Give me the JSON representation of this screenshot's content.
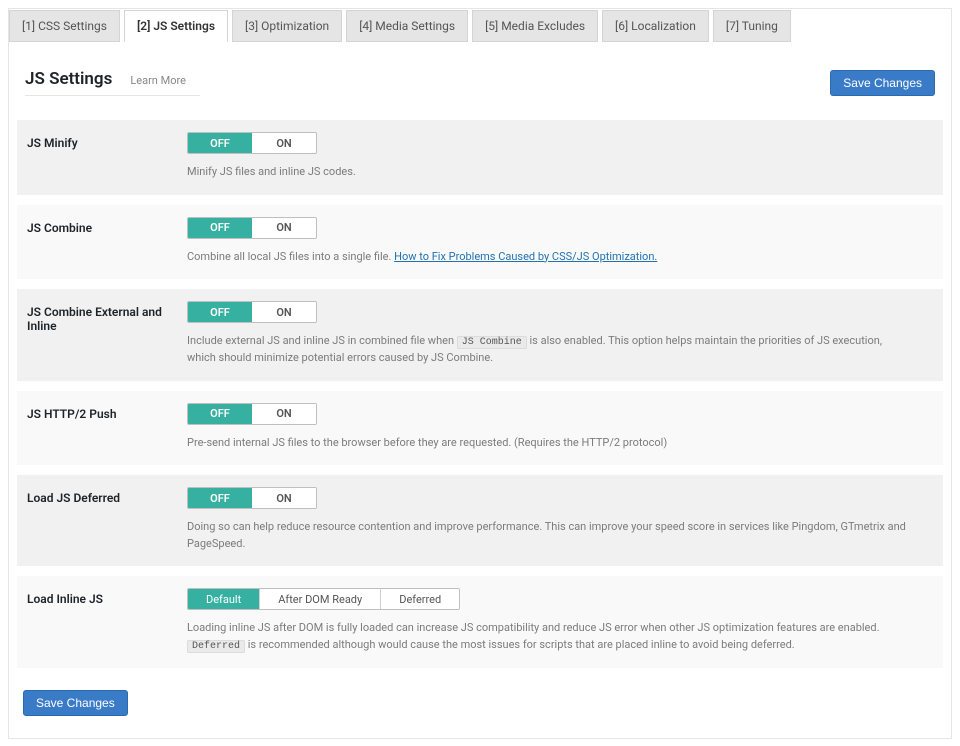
{
  "tabs": [
    {
      "label": "[1] CSS Settings"
    },
    {
      "label": "[2] JS Settings"
    },
    {
      "label": "[3] Optimization"
    },
    {
      "label": "[4] Media Settings"
    },
    {
      "label": "[5] Media Excludes"
    },
    {
      "label": "[6] Localization"
    },
    {
      "label": "[7] Tuning"
    }
  ],
  "header": {
    "title": "JS Settings",
    "learn_more": "Learn More",
    "save_changes": "Save Changes"
  },
  "toggle_labels": {
    "off": "OFF",
    "on": "ON"
  },
  "rows": {
    "minify": {
      "label": "JS Minify",
      "desc": "Minify JS files and inline JS codes."
    },
    "combine": {
      "label": "JS Combine",
      "desc_prefix": "Combine all local JS files into a single file. ",
      "desc_link": "How to Fix Problems Caused by CSS/JS Optimization."
    },
    "combine_ext": {
      "label": "JS Combine External and Inline",
      "desc_pre": "Include external JS and inline JS in combined file when ",
      "code": "JS Combine",
      "desc_post": " is also enabled. This option helps maintain the priorities of JS execution, which should minimize potential errors caused by JS Combine."
    },
    "http2": {
      "label": "JS HTTP/2 Push",
      "desc": "Pre-send internal JS files to the browser before they are requested. (Requires the HTTP/2 protocol)"
    },
    "deferred": {
      "label": "Load JS Deferred",
      "desc": "Doing so can help reduce resource contention and improve performance. This can improve your speed score in services like Pingdom, GTmetrix and PageSpeed."
    },
    "inline": {
      "label": "Load Inline JS",
      "options": [
        "Default",
        "After DOM Ready",
        "Deferred"
      ],
      "desc_line1": "Loading inline JS after DOM is fully loaded can increase JS compatibility and reduce JS error when other JS optimization features are enabled.",
      "desc_code": "Deferred",
      "desc_line2_post": " is recommended although would cause the most issues for scripts that are placed inline to avoid being deferred."
    }
  }
}
